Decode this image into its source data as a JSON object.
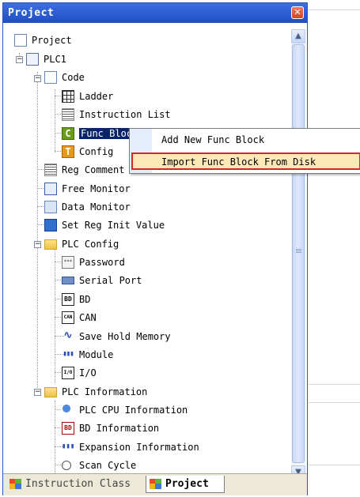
{
  "panel": {
    "title": "Project",
    "close_glyph": "✕"
  },
  "tree": {
    "root": "Project",
    "plc": "PLC1",
    "code": "Code",
    "ladder": "Ladder",
    "instruction_list": "Instruction List",
    "func_block": "Func Block",
    "config": "Config",
    "reg_comment": "Reg Comment",
    "free_monitor": "Free Monitor",
    "data_monitor": "Data Monitor",
    "set_reg_init": "Set Reg Init Value",
    "plc_config": "PLC Config",
    "password": "Password",
    "serial_port": "Serial Port",
    "bd": "BD",
    "can": "CAN",
    "save_hold_memory": "Save Hold Memory",
    "module": "Module",
    "io": "I/O",
    "plc_information": "PLC Information",
    "plc_cpu_information": "PLC CPU Information",
    "bd_information": "BD Information",
    "expansion_information": "Expansion Information",
    "scan_cycle": "Scan Cycle"
  },
  "icons": {
    "bd_text": "BD",
    "can_text": "CAN",
    "io_text": "I/O",
    "bdinfo_text": "BD",
    "c_text": "C",
    "t_text": "T"
  },
  "context_menu": {
    "items": [
      "Add New Func Block",
      "Import Func Block From Disk"
    ],
    "highlighted_index": 1
  },
  "tabs": [
    {
      "label": "Instruction Class",
      "active": false
    },
    {
      "label": "Project",
      "active": true
    }
  ],
  "colors": {
    "titlebar": "#2a57c8",
    "selection": "#0a246a",
    "menu_highlight_border": "#d3272b",
    "menu_highlight_fill": "#fde8b8"
  }
}
